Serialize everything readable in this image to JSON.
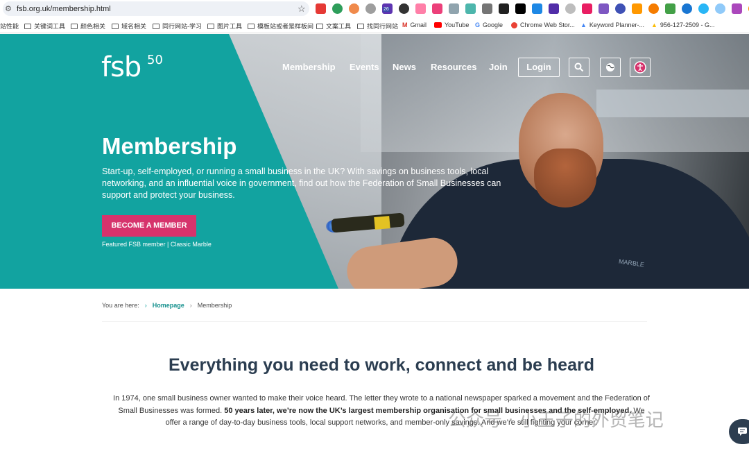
{
  "browser": {
    "url": "fsb.org.uk/membership.html",
    "bookmarks": [
      "站性能",
      "关键词工具",
      "颜色相关",
      "域名相关",
      "同行网站-学习",
      "图片工具",
      "模板站或者是样板间",
      "文案工具",
      "找同行网站",
      "Gmail",
      "YouTube",
      "Google",
      "Chrome Web Stor...",
      "Keyword Planner-...",
      "956-127-2509 - G..."
    ],
    "extension_badge": "26"
  },
  "site": {
    "logo_text": "fsb",
    "logo_sup": "50",
    "nav": [
      "Membership",
      "Events",
      "News",
      "Resources",
      "Join"
    ],
    "login_label": "Login"
  },
  "hero": {
    "title": "Membership",
    "text": "Start-up, self-employed, or running a small business in the UK? With savings on business tools, local networking, and an influential voice in government, find out how the Federation of Small Businesses can support and protect your business.",
    "cta_label": "BECOME A MEMBER",
    "featured": "Featured FSB member | Classic Marble",
    "jacket_text": "MARBLE"
  },
  "breadcrumb": {
    "prefix": "You are here:",
    "home": "Homepage",
    "current": "Membership"
  },
  "intro": {
    "title": "Everything you need to work, connect and be heard",
    "p1": "In 1974, one small business owner wanted to make their voice heard. The letter they wrote to a national newspaper sparked a movement and the Federation of Small Businesses was formed. ",
    "p_bold": "50 years later, we’re now the UK’s largest membership organisation for small businesses and the self-employed.",
    "p2": " We offer a range of day-to-day business tools, local support networks, and member-only savings. And we’re still fighting your corner."
  },
  "watermark": "公众号 · 小王子的外贸笔记",
  "colors": {
    "teal": "#12a3a0",
    "pink": "#d6336c",
    "heading": "#2b3d50"
  }
}
